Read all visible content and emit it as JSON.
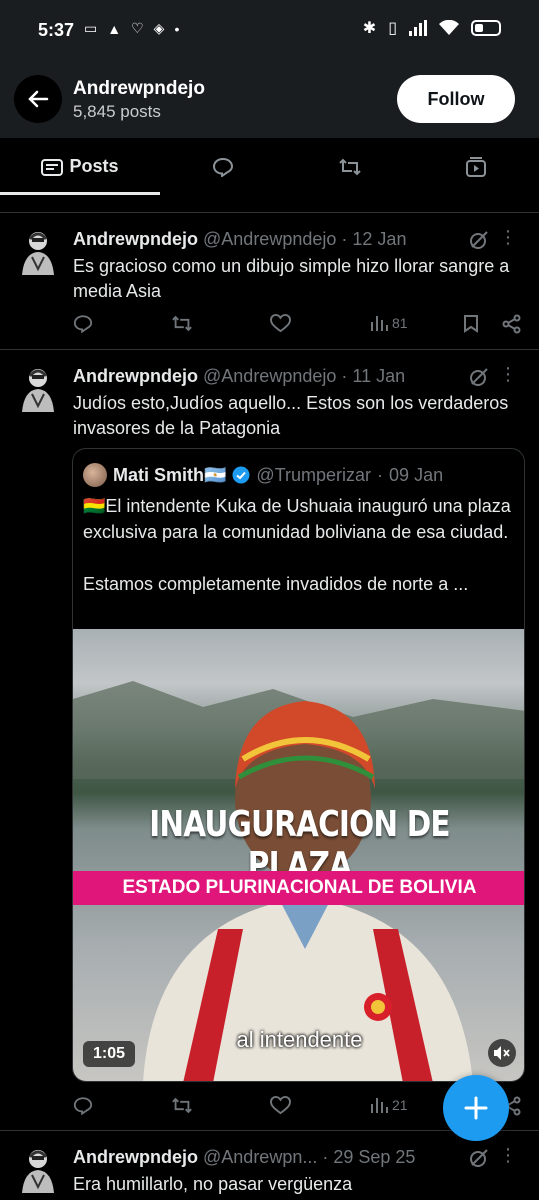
{
  "status_bar": {
    "time": "5:37"
  },
  "header": {
    "name": "Andrewpndejo",
    "posts_count": "5,845 posts",
    "follow_label": "Follow"
  },
  "tabs": [
    {
      "label": "Posts",
      "icon": "posts-icon"
    },
    {
      "label": "",
      "icon": "replies-icon"
    },
    {
      "label": "",
      "icon": "reposts-icon"
    },
    {
      "label": "",
      "icon": "media-icon"
    }
  ],
  "tweets": [
    {
      "name": "Andrewpndejo",
      "handle": "@Andrewpndejo",
      "sep": "·",
      "date": "12 Jan",
      "text": "Es gracioso como un dibujo simple hizo llorar sangre a media Asia",
      "views": "81"
    },
    {
      "name": "Andrewpndejo",
      "handle": "@Andrewpndejo",
      "sep": "·",
      "date": "11 Jan",
      "text": "Judíos esto,Judíos aquello... Estos son los verdaderos invasores de la Patagonia",
      "views": "21",
      "quote": {
        "name": "Mati Smith🇦🇷",
        "handle": "@Trumperizar",
        "sep": "·",
        "date": "09 Jan",
        "text_line1": "🇧🇴El intendente Kuka de Ushuaia inauguró una plaza exclusiva para la comunidad boliviana de esa ciudad.",
        "text_line2": "Estamos completamente invadidos de norte a ...",
        "video": {
          "title": "INAUGURACION DE PLAZA",
          "banner": "ESTADO PLURINACIONAL DE BOLIVIA",
          "caption": "al intendente",
          "duration": "1:05"
        }
      }
    },
    {
      "name": "Andrewpndejo",
      "handle": "@Andrewpn...",
      "sep": "·",
      "date": "29 Sep 25",
      "text": "Era humillarlo, no pasar vergüenza"
    }
  ],
  "colors": {
    "accent": "#1d9bf0",
    "muted": "#71767b",
    "pink_banner": "#e0167a"
  }
}
